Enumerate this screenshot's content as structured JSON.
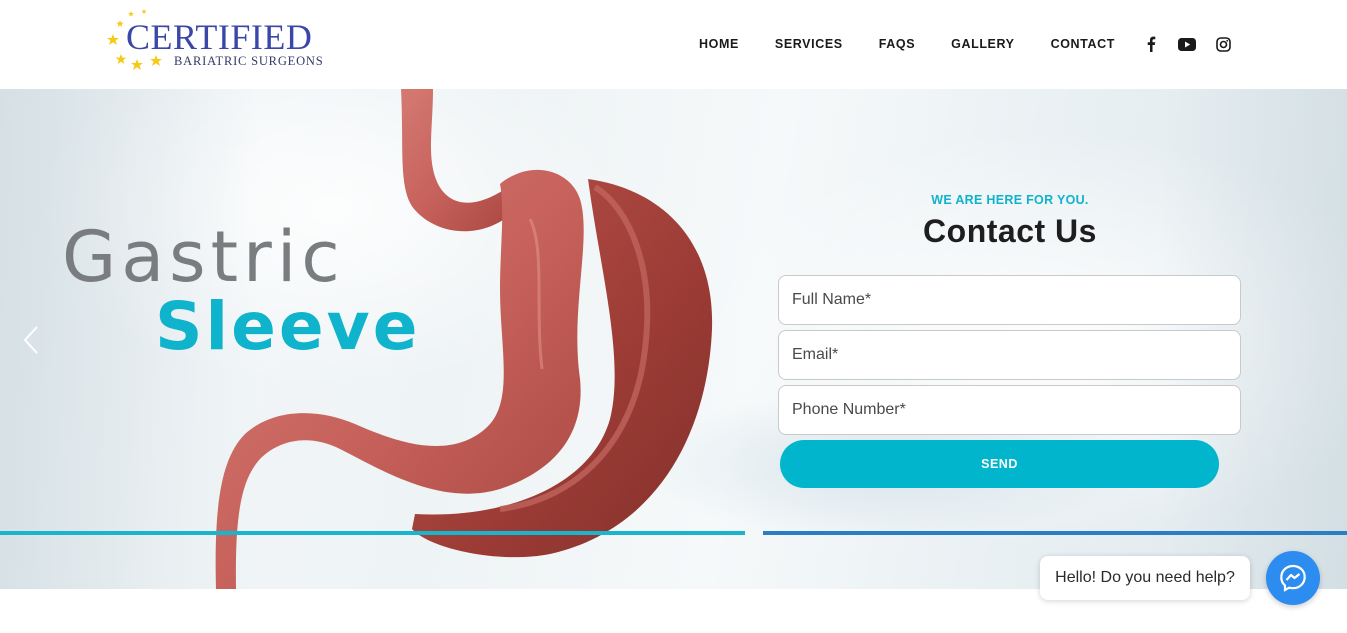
{
  "header": {
    "logo": {
      "title": "CERTIFIED",
      "subtitle": "BARIATRIC SURGEONS"
    },
    "nav": [
      {
        "label": "HOME"
      },
      {
        "label": "SERVICES"
      },
      {
        "label": "FAQS"
      },
      {
        "label": "GALLERY"
      },
      {
        "label": "CONTACT"
      }
    ],
    "social": [
      "facebook-icon",
      "youtube-icon",
      "instagram-icon"
    ]
  },
  "hero": {
    "title_line1": "Gastric",
    "title_line2": "Sleeve",
    "accent_color": "#0fb3cb"
  },
  "contact": {
    "kicker": "WE ARE HERE FOR YOU.",
    "title": "Contact Us",
    "fields": {
      "name_placeholder": "Full Name*",
      "email_placeholder": "Email*",
      "phone_placeholder": "Phone Number*"
    },
    "send_label": "SEND",
    "button_color": "#00b5cc"
  },
  "chat": {
    "message": "Hello! Do you need help?",
    "icon": "messenger-icon"
  }
}
